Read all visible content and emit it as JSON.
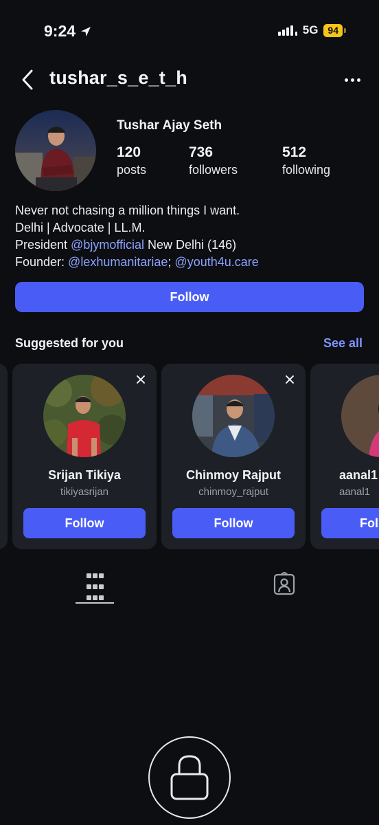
{
  "status_bar": {
    "time": "9:24",
    "network": "5G",
    "battery": "94",
    "icons": [
      "location-arrow-icon",
      "signal-bars-icon"
    ]
  },
  "header": {
    "username": "tushar_s_e_t_h",
    "back_icon": "chevron-left-icon",
    "more_icon": "more-horizontal-icon"
  },
  "profile": {
    "full_name": "Tushar Ajay Seth",
    "stats": [
      {
        "value": "120",
        "label": "posts"
      },
      {
        "value": "736",
        "label": "followers"
      },
      {
        "value": "512",
        "label": "following"
      }
    ],
    "bio": {
      "line1": "Never not chasing a million things I want.",
      "line2": "Delhi | Advocate | LL.M.",
      "line3_prefix": "President ",
      "line3_mention": "@bjymofficial",
      "line3_suffix": " New Delhi (146)",
      "line4_prefix": "Founder: ",
      "line4_mention1": "@lexhumanitariae",
      "line4_sep": "; ",
      "line4_mention2": "@youth4u.care"
    },
    "follow_label": "Follow"
  },
  "suggested": {
    "title": "Suggested for you",
    "see_all": "See all",
    "cards": [
      {
        "name": "Srijan Tikiya",
        "handle": "tikiyasrijan",
        "follow": "Follow"
      },
      {
        "name": "Chinmoy Rajput",
        "handle": "chinmoy_rajput",
        "follow": "Follow"
      },
      {
        "name": "aanal1",
        "handle": "aanal1",
        "follow": "Fol"
      }
    ]
  },
  "tabs": {
    "active": "posts-grid",
    "items": [
      "grid-icon",
      "tagged-person-icon"
    ]
  },
  "lock_icon": "lock-icon",
  "colors": {
    "background": "#0c0e11",
    "card": "#1d2026",
    "accent": "#4a5cf6",
    "link": "#8da2ff",
    "battery": "#f5c518"
  }
}
